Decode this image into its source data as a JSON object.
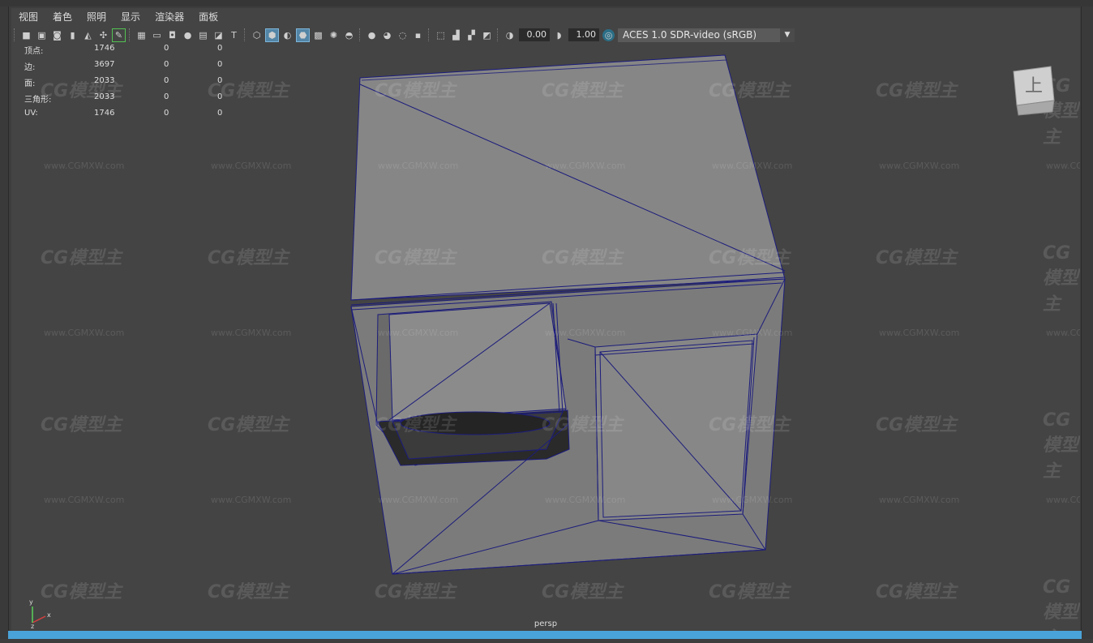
{
  "menu": [
    "视图",
    "着色",
    "照明",
    "显示",
    "渲染器",
    "面板"
  ],
  "toolbar": {
    "exposure_value": "0.00",
    "gamma_value": "1.00",
    "color_space": "ACES 1.0 SDR-video (sRGB)"
  },
  "stats": [
    {
      "label": "顶点:",
      "v1": "1746",
      "v2": "0",
      "v3": "0"
    },
    {
      "label": "边:",
      "v1": "3697",
      "v2": "0",
      "v3": "0"
    },
    {
      "label": "面:",
      "v1": "2033",
      "v2": "0",
      "v3": "0"
    },
    {
      "label": "三角形:",
      "v1": "2033",
      "v2": "0",
      "v3": "0"
    },
    {
      "label": "UV:",
      "v1": "1746",
      "v2": "0",
      "v3": "0"
    }
  ],
  "viewcube_label": "上",
  "camera_name": "persp",
  "watermark": {
    "logo": "CG模型主",
    "url": "www.CGMXW.com"
  },
  "axis": {
    "x": "x",
    "y": "y",
    "z": "z"
  },
  "colors": {
    "accent": "#4aa3d8",
    "wireframe": "#1a1a7a",
    "surface": "#858585"
  }
}
